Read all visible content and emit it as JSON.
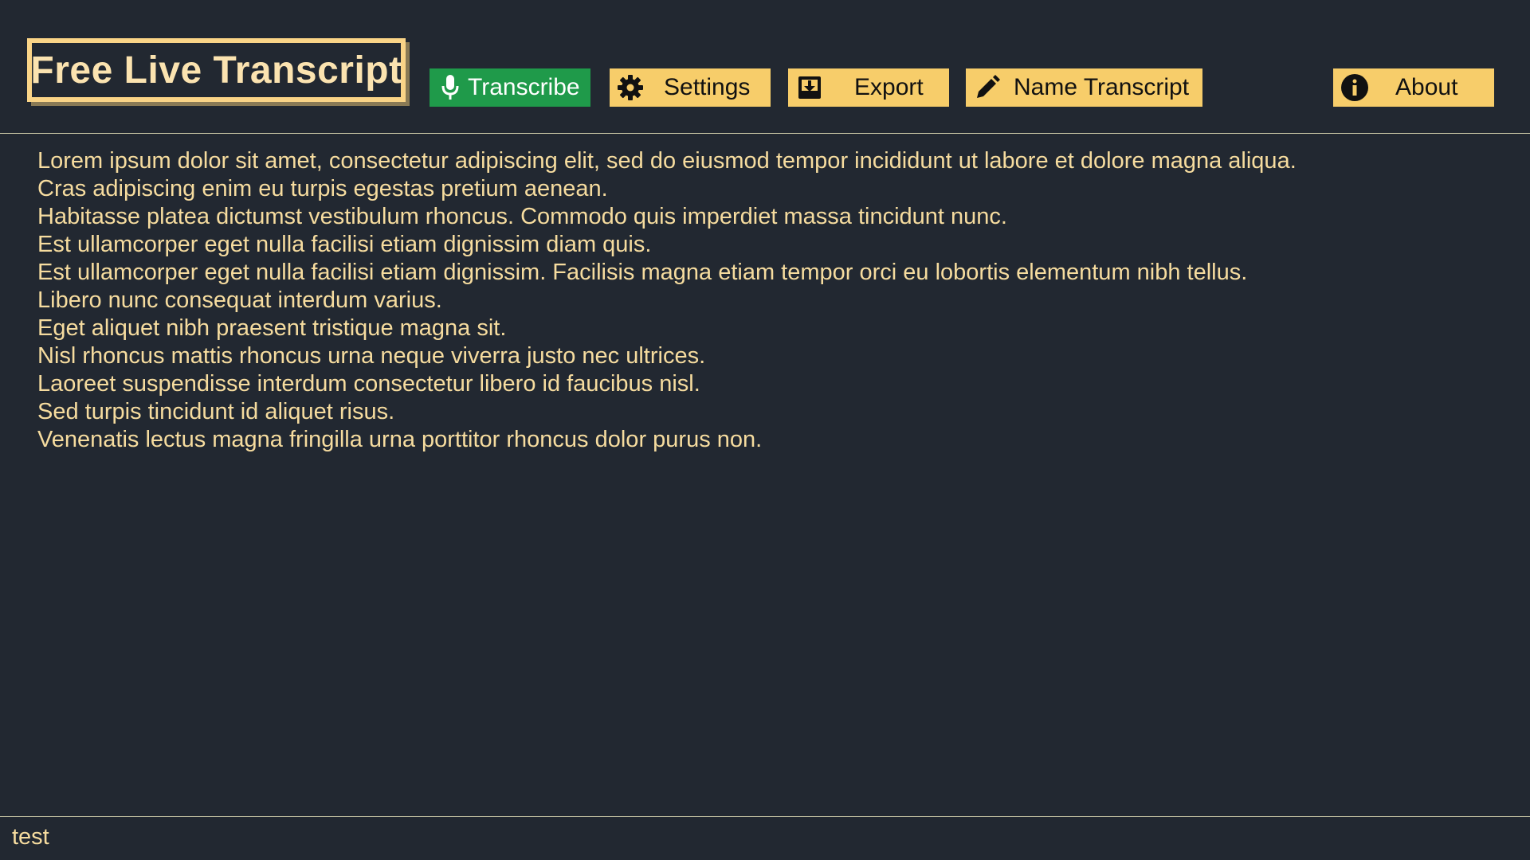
{
  "header": {
    "app_title": "Free Live Transcript",
    "buttons": {
      "transcribe": {
        "label": "Transcribe",
        "icon": "microphone-icon"
      },
      "settings": {
        "label": "Settings",
        "icon": "gear-icon"
      },
      "export": {
        "label": "Export",
        "icon": "download-box-icon"
      },
      "name_transcript": {
        "label": "Name Transcript",
        "icon": "pencil-icon"
      },
      "about": {
        "label": "About",
        "icon": "info-icon"
      }
    }
  },
  "transcript": {
    "lines": [
      "Lorem ipsum dolor sit amet, consectetur adipiscing elit, sed do eiusmod tempor incididunt ut labore et dolore magna aliqua.",
      "Cras adipiscing enim eu turpis egestas pretium aenean.",
      "Habitasse platea dictumst vestibulum rhoncus. Commodo quis imperdiet massa tincidunt nunc.",
      "Est ullamcorper eget nulla facilisi etiam dignissim diam quis.",
      "Est ullamcorper eget nulla facilisi etiam dignissim. Facilisis magna etiam tempor orci eu lobortis elementum nibh tellus.",
      "Libero nunc consequat interdum varius.",
      "Eget aliquet nibh praesent tristique magna sit.",
      "Nisl rhoncus mattis rhoncus urna neque viverra justo nec ultrices.",
      "Laoreet suspendisse interdum consectetur libero id faucibus nisl.",
      "Sed turpis tincidunt id aliquet risus.",
      "Venenatis lectus magna fringilla urna porttitor rhoncus dolor purus non."
    ]
  },
  "footer": {
    "text": "test"
  },
  "colors": {
    "background": "#222831",
    "accent_yellow": "#f7cd6a",
    "accent_green": "#1f9a4a",
    "text": "#f6dc9f"
  }
}
